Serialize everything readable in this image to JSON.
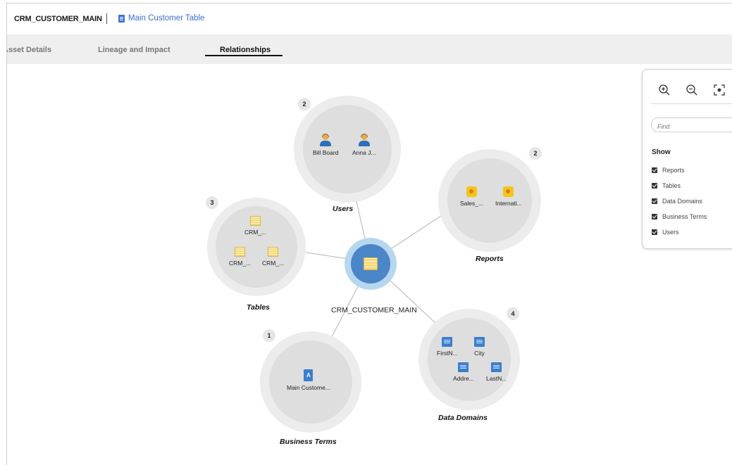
{
  "header": {
    "asset_name": "CRM_CUSTOMER_MAIN",
    "breadcrumb": "Main Customer Table",
    "breadcrumb_icon": "table-doc-icon"
  },
  "tabs": [
    {
      "label": "Asset Details",
      "active": false
    },
    {
      "label": "Lineage and Impact",
      "active": false
    },
    {
      "label": "Relationships",
      "active": true
    }
  ],
  "graph": {
    "center": {
      "label": "CRM_CUSTOMER_MAIN",
      "icon": "table-icon"
    },
    "groups": {
      "users": {
        "label": "Users",
        "count": "2",
        "items": [
          "Bill Board",
          "Anna J..."
        ]
      },
      "reports": {
        "label": "Reports",
        "count": "2",
        "items": [
          "Sales_...",
          "Internati..."
        ]
      },
      "tables": {
        "label": "Tables",
        "count": "3",
        "items": [
          "CRM_...",
          "CRM_...",
          "CRM_..."
        ]
      },
      "business_terms": {
        "label": "Business Terms",
        "count": "1",
        "items": [
          "Main Custome..."
        ]
      },
      "data_domains": {
        "label": "Data Domains",
        "count": "4",
        "items": [
          "FirstN...",
          "City",
          "Addre...",
          "LastN..."
        ]
      }
    }
  },
  "panel": {
    "tools": [
      "zoom-in-icon",
      "zoom-out-icon",
      "fit-view-icon"
    ],
    "find_placeholder": "Find",
    "show_title": "Show",
    "filters": [
      "Reports",
      "Tables",
      "Data Domains",
      "Business Terms",
      "Users"
    ]
  },
  "colors": {
    "link": "#3a6fd1",
    "center_outer": "#b7d7f1",
    "center_inner": "#4a86c8",
    "node_outer": "#ececec",
    "node_inner": "#dedede"
  }
}
